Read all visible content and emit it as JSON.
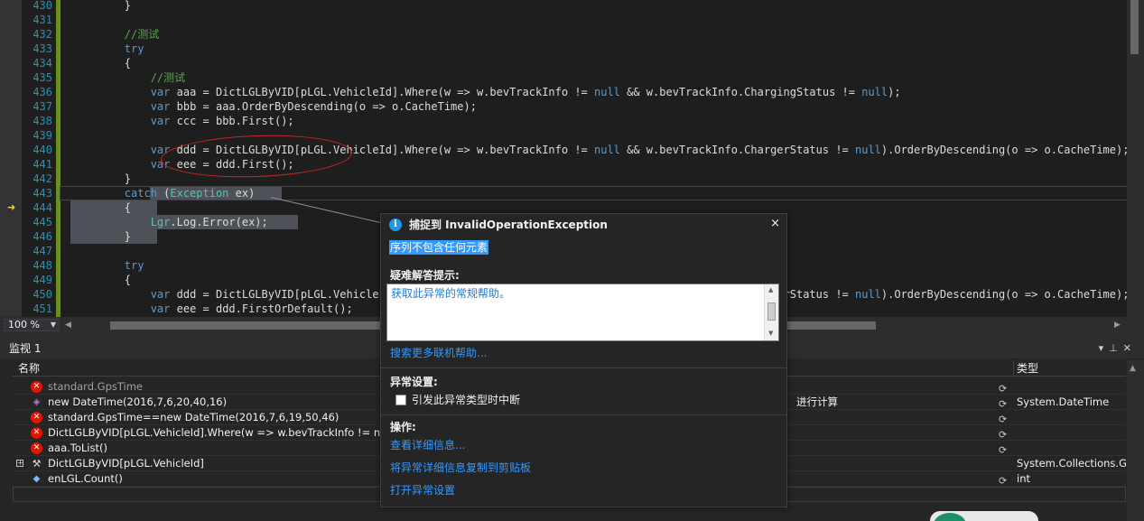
{
  "editor": {
    "lines": [
      {
        "no": "430",
        "html": "        }"
      },
      {
        "no": "431",
        "html": ""
      },
      {
        "no": "432",
        "html": "        <span class=\"cm\">//测试</span>"
      },
      {
        "no": "433",
        "html": "        <span class=\"kw\">try</span>"
      },
      {
        "no": "434",
        "html": "        {"
      },
      {
        "no": "435",
        "html": "            <span class=\"cm\">//测试</span>"
      },
      {
        "no": "436",
        "html": "            <span class=\"kw\">var</span> aaa = DictLGLByVID[pLGL.VehicleId].Where(w =&gt; w.bevTrackInfo != <span class=\"kw\">null</span> &amp;&amp; w.bevTrackInfo.ChargingStatus != <span class=\"kw\">null</span>);"
      },
      {
        "no": "437",
        "html": "            <span class=\"kw\">var</span> bbb = aaa.OrderByDescending(o =&gt; o.CacheTime);"
      },
      {
        "no": "438",
        "html": "            <span class=\"kw\">var</span> ccc = bbb.First();"
      },
      {
        "no": "439",
        "html": ""
      },
      {
        "no": "440",
        "html": "            <span class=\"kw\">var</span> ddd = DictLGLByVID[pLGL.VehicleId].Where(w =&gt; w.bevTrackInfo != <span class=\"kw\">null</span> &amp;&amp; w.bevTrackInfo.ChargerStatus != <span class=\"kw\">null</span>).OrderByDescending(o =&gt; o.CacheTime);"
      },
      {
        "no": "441",
        "html": "            <span class=\"kw\">var</span> eee = ddd.First();"
      },
      {
        "no": "442",
        "html": "        }"
      },
      {
        "no": "443",
        "html": "        <span class=\"kw\">catch</span> (<span class=\"ty\">Exception</span> ex)"
      },
      {
        "no": "444",
        "html": "        {"
      },
      {
        "no": "445",
        "html": "            <span class=\"ty\">Lgr</span>.Log.Error(ex);"
      },
      {
        "no": "446",
        "html": "        }"
      },
      {
        "no": "447",
        "html": ""
      },
      {
        "no": "448",
        "html": "        <span class=\"kw\">try</span>"
      },
      {
        "no": "449",
        "html": "        {"
      },
      {
        "no": "450",
        "html": "            <span class=\"kw\">var</span> ddd = DictLGLByVID[pLGL.VehicleId].Where(w =&gt; w.bevTrackInfo != <span class=\"kw\">null</span> &amp;&amp; w.bevTrackInfo.ChargerStatus != <span class=\"kw\">null</span>).OrderByDescending(o =&gt; o.CacheTime);"
      },
      {
        "no": "451",
        "html": "            <span class=\"kw\">var</span> eee = ddd.FirstOrDefault();"
      }
    ],
    "zoom": "100 %"
  },
  "watch": {
    "title": "监视 1",
    "col_name": "名称",
    "col_type": "类型",
    "rows": [
      {
        "icon": "error-icon",
        "name": "standard.GpsTime",
        "value": "",
        "type": "",
        "dim": true
      },
      {
        "icon": "property-icon",
        "name": "new DateTime(2016,7,6,20,40,16)",
        "value": "进行计算",
        "type": "System.DateTime",
        "dim": false
      },
      {
        "icon": "error-icon",
        "name": "standard.GpsTime==new DateTime(2016,7,6,19,50,46)",
        "value": "",
        "type": "",
        "dim": false
      },
      {
        "icon": "error-icon",
        "name": "DictLGLByVID[pLGL.VehicleId].Where(w => w.bevTrackInfo != null &&",
        "value": "",
        "type": "",
        "dim": false
      },
      {
        "icon": "error-icon",
        "name": "aaa.ToList()",
        "value": "",
        "type": "",
        "dim": false
      },
      {
        "icon": "wrench-icon",
        "name": "DictLGLByVID[pLGL.VehicleId]",
        "value": "",
        "type": "System.Collections.Gen",
        "dim": false,
        "expandable": true
      },
      {
        "icon": "field-icon",
        "name": "enLGL.Count()",
        "value": "",
        "type": "int",
        "dim": false
      }
    ]
  },
  "exception": {
    "title": "捕捉到 InvalidOperationException",
    "message": "序列不包含任何元素",
    "hint_heading": "疑难解答提示:",
    "hint_text": "获取此异常的常规帮助。",
    "search_link": "搜索更多联机帮助...",
    "settings_heading": "异常设置:",
    "break_checkbox_label": "引发此异常类型时中断",
    "actions_heading": "操作:",
    "action_details": "查看详细信息...",
    "action_copy": "将异常详细信息复制到剪贴板",
    "action_settings": "打开异常设置",
    "close_glyph": "×",
    "info_glyph": "i"
  },
  "colors": {
    "editor_bg": "#1e1e1e",
    "keyword": "#569cd6",
    "comment": "#57a64a",
    "type": "#4ec9b0",
    "link": "#3399ff",
    "error": "#e51400"
  }
}
